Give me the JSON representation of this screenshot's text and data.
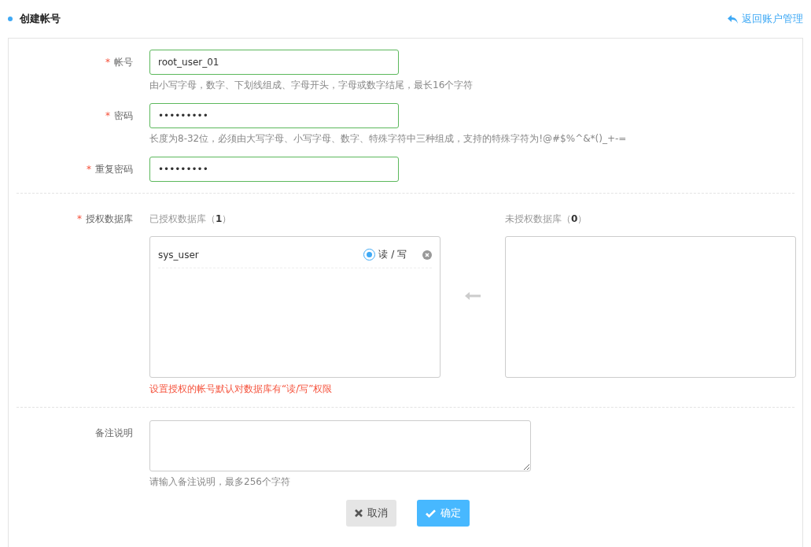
{
  "header": {
    "title": "创建帐号",
    "back_link": "返回账户管理"
  },
  "fields": [
    {
      "kind": "input",
      "label": "帐号",
      "mark": "*",
      "value": "root_user_01",
      "hint": "由小写字母，数字、下划线组成、字母开头，字母或数字结尾，最长16个字符"
    },
    {
      "kind": "input",
      "label": "密码",
      "mark": "*",
      "value": "•••••••••",
      "hint": "长度为8-32位，必须由大写字母、小写字母、数字、特殊字符中三种组成，支持的特殊字符为!@#$%^&*()_+-="
    },
    {
      "kind": "input",
      "label": "重复密码",
      "mark": "*",
      "value": "•••••••••"
    }
  ],
  "databases": {
    "label": "授权数据库",
    "mark": "*",
    "authorized": {
      "title": "已授权数据库（**1**）",
      "items": [
        {
          "name": "sys_user",
          "permission": "读 / 写",
          "selected": true
        }
      ]
    },
    "unauthorized": {
      "title": "未授权数据库（**0**）"
    },
    "warning": "设置授权的帐号默认对数据库有“读/写”权限"
  },
  "remark": {
    "label": "备注说明",
    "hint": "请输入备注说明，最多256个字符"
  },
  "buttons": [
    {
      "kind": "cancel",
      "label": "取消"
    },
    {
      "kind": "confirm",
      "label": "确定"
    }
  ]
}
